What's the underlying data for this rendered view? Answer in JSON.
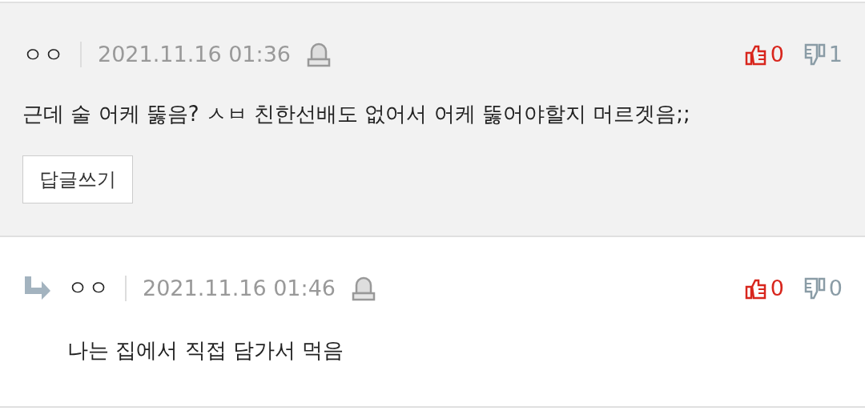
{
  "comments": [
    {
      "kind": "comment",
      "author": "ㅇㅇ",
      "date": "2021.11.16 01:36",
      "likes": "0",
      "dislikes": "1",
      "body": "근데 술 어케 뚫음? ㅅㅂ 친한선배도 없어서 어케 뚫어야할지 머르겟음;;",
      "reply_button": "답글쓰기"
    },
    {
      "kind": "reply",
      "author": "ㅇㅇ",
      "date": "2021.11.16 01:46",
      "likes": "0",
      "dislikes": "0",
      "body": "나는 집에서 직접 담가서 먹음"
    }
  ]
}
